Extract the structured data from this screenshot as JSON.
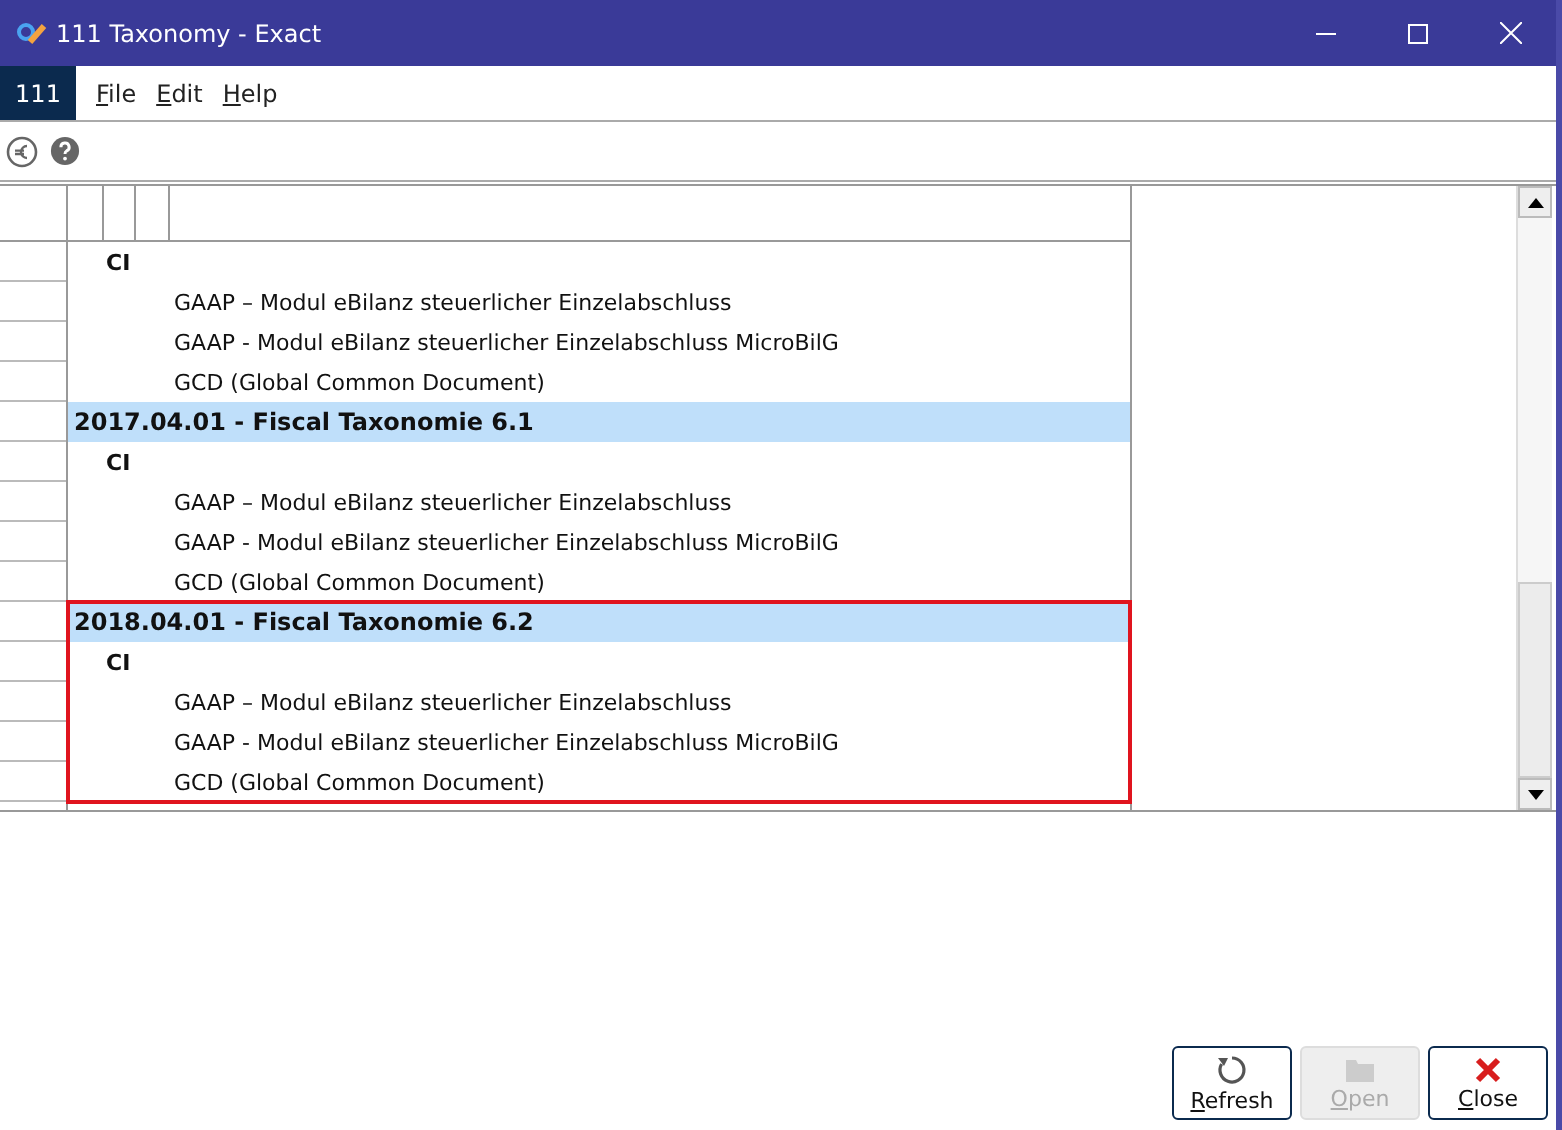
{
  "window": {
    "title": "111 Taxonomy - Exact"
  },
  "company": "111",
  "menu": [
    {
      "label": "File"
    },
    {
      "label": "Edit"
    },
    {
      "label": "Help"
    }
  ],
  "tree": [
    {
      "kind": "category",
      "label": "CI",
      "highlighted": false,
      "children": [
        {
          "kind": "document",
          "label": "GAAP – Modul eBilanz steuerlicher Einzelabschluss"
        },
        {
          "kind": "document",
          "label": "GAAP - Modul eBilanz steuerlicher Einzelabschluss MicroBilG"
        },
        {
          "kind": "document",
          "label": "GCD (Global Common Document)"
        }
      ]
    },
    {
      "kind": "group",
      "label": "2017.04.01 - Fiscal Taxonomie 6.1",
      "highlighted": false,
      "children": [
        {
          "kind": "category",
          "label": "CI",
          "children": [
            {
              "kind": "document",
              "label": "GAAP – Modul eBilanz steuerlicher Einzelabschluss"
            },
            {
              "kind": "document",
              "label": "GAAP - Modul eBilanz steuerlicher Einzelabschluss MicroBilG"
            },
            {
              "kind": "document",
              "label": "GCD (Global Common Document)"
            }
          ]
        }
      ]
    },
    {
      "kind": "group",
      "label": "2018.04.01 - Fiscal Taxonomie 6.2",
      "highlighted": true,
      "children": [
        {
          "kind": "category",
          "label": "CI",
          "children": [
            {
              "kind": "document",
              "label": "GAAP – Modul eBilanz steuerlicher Einzelabschluss"
            },
            {
              "kind": "document",
              "label": "GAAP - Modul eBilanz steuerlicher Einzelabschluss MicroBilG"
            },
            {
              "kind": "document",
              "label": "GCD (Global Common Document)"
            }
          ]
        }
      ]
    }
  ],
  "buttons": [
    {
      "kind": "refresh",
      "label": "Refresh",
      "disabled": false
    },
    {
      "kind": "open",
      "label": "Open",
      "disabled": true
    },
    {
      "kind": "close",
      "label": "Close",
      "disabled": false
    }
  ]
}
